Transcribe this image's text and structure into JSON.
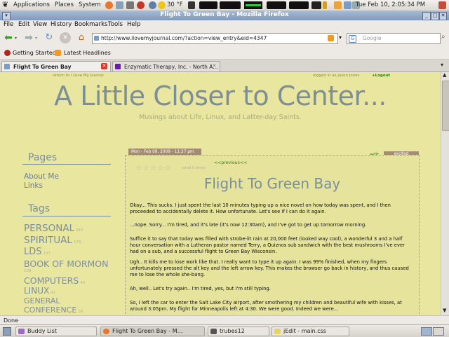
{
  "panel": {
    "applications": "Applications",
    "places": "Places",
    "system": "System",
    "weather": "30 °F",
    "clock": "Tue Feb 10,  2:05:34 PM"
  },
  "window": {
    "title": "Flight To Green Bay - Mozilla Firefox"
  },
  "menu": [
    "File",
    "Edit",
    "View",
    "History",
    "Bookmarks",
    "Tools",
    "Help"
  ],
  "nav": {
    "url": "http://www.ilovemyjournal.com/?action=view_entry&eid=4347",
    "search_placeholder": "Google"
  },
  "bookmarks": [
    "Getting Started",
    "Latest Headlines"
  ],
  "tabs": [
    "Flight To Green Bay",
    "Enzymatic Therapy, Inc. - North A..."
  ],
  "page": {
    "return_link": "return to I Love My Journal",
    "logged_in": "logged in as Jason Jones",
    "logout": "+Logout",
    "site_title": "A Little Closer to Center...",
    "tagline": "Musings about Life, Linux, and Latter-day Saints.",
    "pages_heading": "Pages",
    "pages": [
      "About Me",
      "Links"
    ],
    "tags_heading": "Tags",
    "tags": [
      {
        "name": "PERSONAL",
        "count": "342"
      },
      {
        "name": "SPIRITUAL",
        "count": "178"
      },
      {
        "name": "LDS",
        "count": "137"
      },
      {
        "name": "BOOK OF MORMON",
        "count": "109"
      },
      {
        "name": "COMPUTERS",
        "count": "44"
      },
      {
        "name": "LINUX",
        "count": "41"
      },
      {
        "name": "GENERAL",
        "count": ""
      },
      {
        "name": "CONFERENCE",
        "count": "36"
      }
    ],
    "post": {
      "date": "Mon - Feb 09, 2009 - 11:27 pm",
      "edit": "edit",
      "mood": "excited",
      "previous": "<<previous<<",
      "rate_text": "rated 0 times",
      "title": "Flight To Green Bay",
      "paragraphs": [
        "Okay...  This sucks.  I just spent the last 10 minutes typing up a nice novel on how today was spent, and I then proceeded to accidentally delete it.  How unfortunate.  Let's see if I can do it again.",
        "...nope.  Sorry...  I'm tired, and it's late (it's now 12:30am), and I've got to get up tomorrow morning.",
        "Suffice it to say that today was filled with strobe-lit rain at 20,000 feet (looked way cool), a wonderful 3 and a half hour conversation with a Lutheran pastor named Terry, a Quiznos sub sandwich with the best mushrooms I've ever had on a sub, and a successful flight to Green Bay Wisconsin.",
        "Ugh..  It kills me to lose work like that.  I really want to type it up again.  I was 99% finished, when my fingers unfortunately pressed the alt key and the left arrow key.  This makes the browser go back in history, and thus caused me to lose the whole she-bang.",
        "Ah, well..  Let's try again..  I'm tired, yes, but I'm still typing.",
        "So, I left the car to enter the Salt Lake City airport, after smothering my children and beautiful wife with kisses, at around 3:05pm.  My flight for Minneapolis left at 4:30.  We were good.  Indeed we were..."
      ]
    }
  },
  "status": "Done",
  "taskbar": [
    "Buddy List",
    "Flight To Green Bay - M...",
    "trubes12",
    "jEdit - main.css"
  ]
}
